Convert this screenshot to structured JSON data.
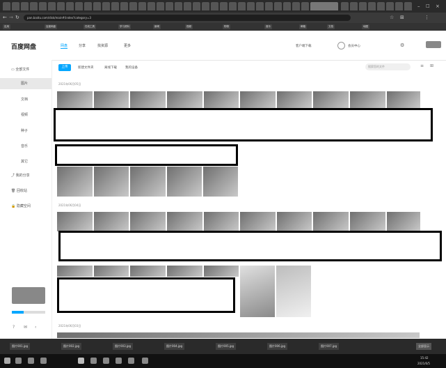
{
  "browser": {
    "url": "pan.baidu.com/disk/main#/index?category=3",
    "bookmarks": [
      "应用",
      "百度网盘",
      "在线工具",
      "学习资料",
      "新闻",
      "视频",
      "购物",
      "音乐",
      "邮箱",
      "文档",
      "地图"
    ]
  },
  "header": {
    "logo": "百度网盘",
    "tabs": [
      "网盘",
      "分享",
      "找资源",
      "更多"
    ],
    "right_text": "客户端下载",
    "user": "会员中心"
  },
  "sidebar": {
    "items": [
      "全部文件",
      "图片",
      "文档",
      "视频",
      "种子",
      "音乐",
      "其它",
      "我的分享",
      "回收站",
      "隐藏空间"
    ],
    "selected_index": 1
  },
  "toolbar": {
    "buttons": [
      "上传",
      "新建文件夹",
      "离线下载",
      "我的设备"
    ],
    "search_placeholder": "搜索您的文件"
  },
  "sections": [
    {
      "date": "2021年06月05日"
    },
    {
      "date": "2021年06月04日"
    },
    {
      "date": "2021年06月03日"
    }
  ],
  "downloads": [
    "图片001.jpg",
    "图片002.jpg",
    "图片003.jpg",
    "图片004.jpg",
    "图片005.jpg",
    "图片006.jpg",
    "图片007.jpg"
  ],
  "downloads_action": "全部显示",
  "taskbar": {
    "time": "15:42",
    "date": "2021/6/5"
  }
}
